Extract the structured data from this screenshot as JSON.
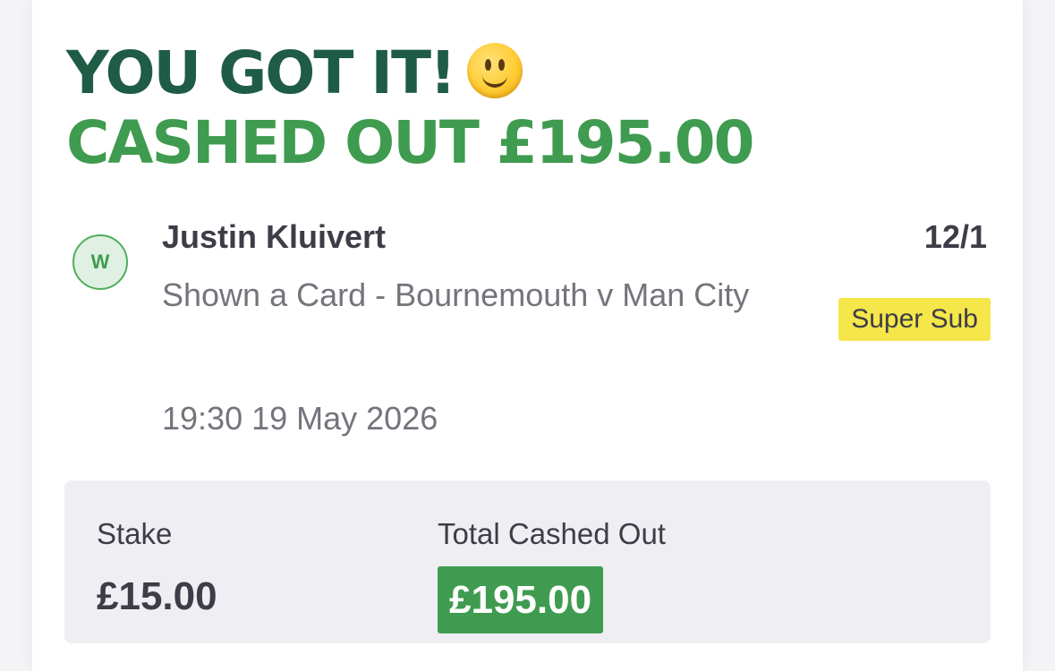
{
  "header": {
    "title": "YOU GOT IT!",
    "emoji_name": "slightly-smiling-face-icon",
    "subtitle": "CASHED OUT £195.00"
  },
  "bet": {
    "result_badge": "W",
    "selection": "Justin Kluivert",
    "odds": "12/1",
    "market": "Shown a Card - Bournemouth v Man City",
    "tag": "Super Sub",
    "datetime": "19:30 19 May 2026"
  },
  "summary": {
    "stake_label": "Stake",
    "stake_value": "£15.00",
    "cashout_label": "Total Cashed Out",
    "cashout_value": "£195.00"
  },
  "colors": {
    "headline_dark_green": "#1f5c45",
    "headline_green": "#3f9b4f",
    "tag_yellow": "#f5e64a",
    "summary_bg": "#efeff3",
    "cashout_green": "#3f9b4f"
  }
}
